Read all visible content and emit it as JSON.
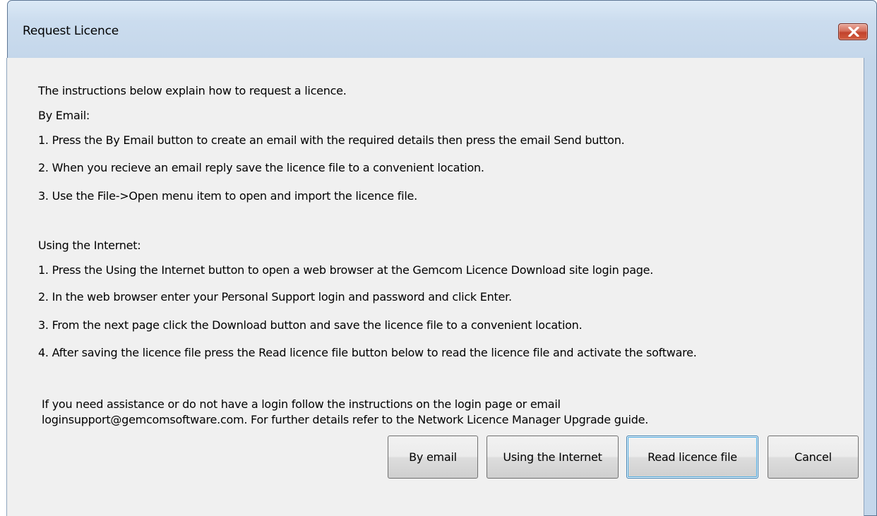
{
  "window": {
    "title": "Request Licence",
    "close_icon": "close-icon"
  },
  "instructions": {
    "intro": "The instructions below explain how to request a licence.",
    "email_heading": "By Email:",
    "email_steps": [
      "1. Press the By Email button to create an email with the required details then press the email Send button.",
      "2. When you recieve an email reply save the licence file to a convenient location.",
      "3. Use the File->Open menu item to open and import the licence file."
    ],
    "internet_heading": "Using the Internet:",
    "internet_steps": [
      "1. Press the Using the Internet button to open a web browser at the Gemcom Licence Download site login page.",
      "2. In the web browser enter your Personal Support login and password and click Enter.",
      "3. From the next page click the Download button and save the licence file to a convenient location.",
      "4. After saving the licence file press the Read licence file button below to read the licence file and activate the software."
    ],
    "assistance_line1": "If you need assistance or do not have a login follow the instructions on the login page or email",
    "assistance_line2": "loginsupport@gemcomsoftware.com.  For further details refer to the Network Licence Manager Upgrade guide."
  },
  "buttons": {
    "by_email": "By email",
    "using_internet": "Using the Internet",
    "read_licence": "Read licence file",
    "cancel": "Cancel"
  }
}
